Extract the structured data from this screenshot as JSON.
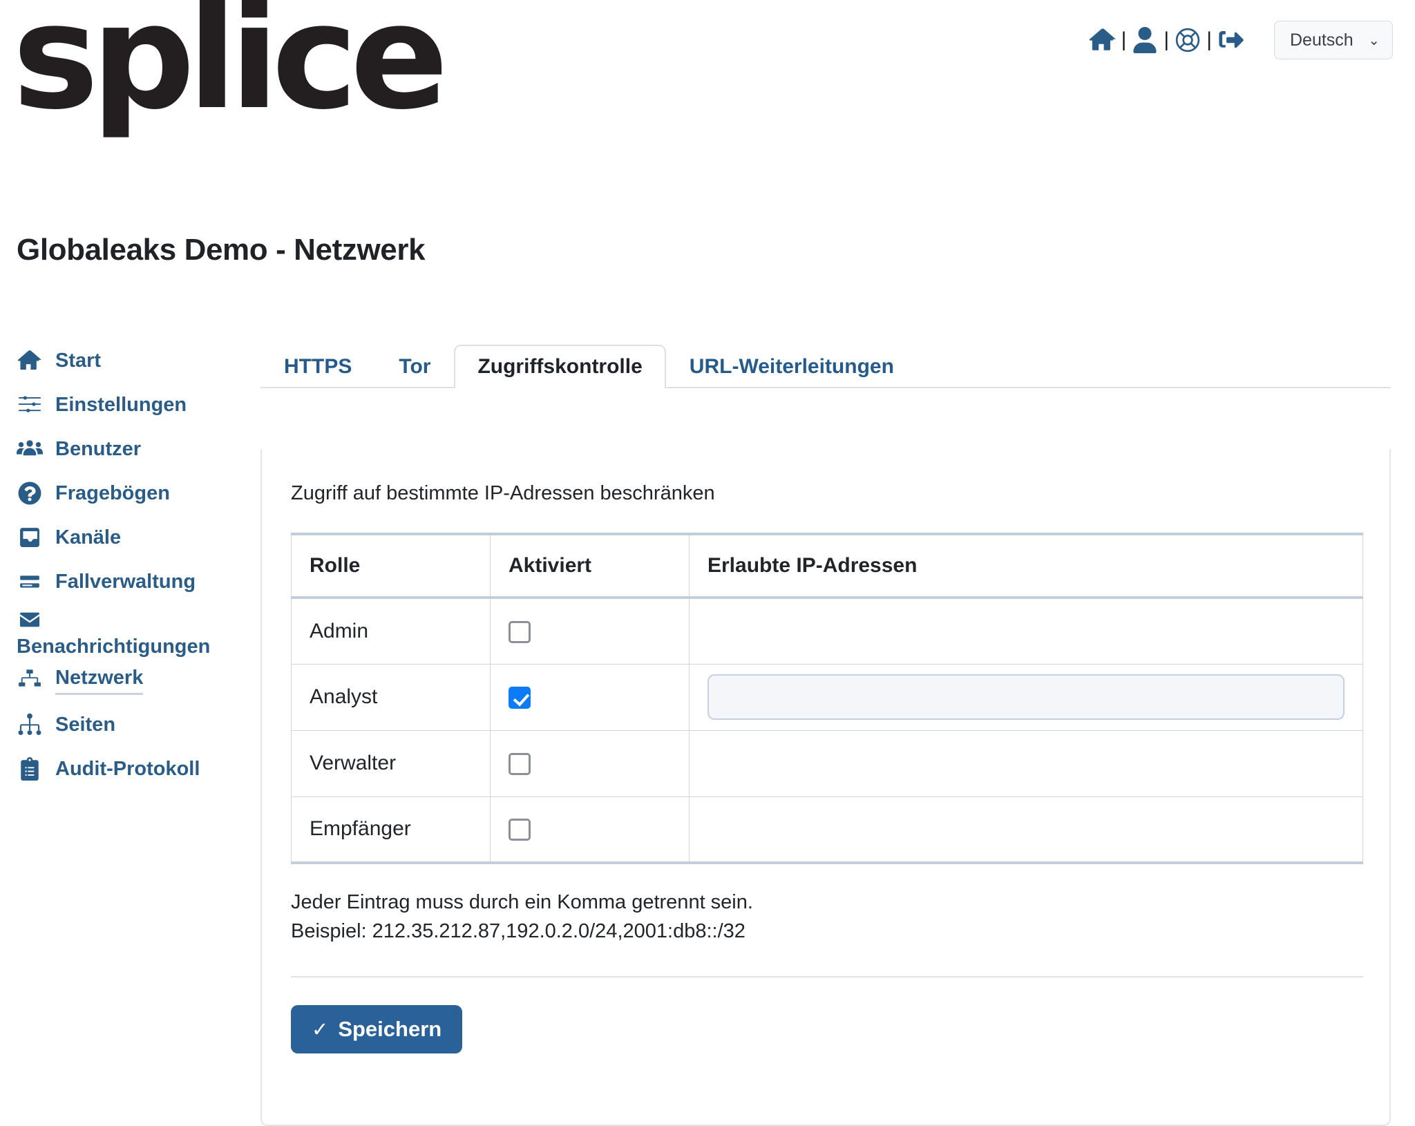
{
  "brand": {
    "logo_text": "splice"
  },
  "header": {
    "icons": [
      {
        "name": "home-icon",
        "label": "Start"
      },
      {
        "name": "user-icon",
        "label": "Konto"
      },
      {
        "name": "lifebuoy-icon",
        "label": "Hilfe"
      },
      {
        "name": "logout-icon",
        "label": "Abmelden"
      }
    ],
    "separator": "|",
    "language": {
      "value": "Deutsch",
      "chevron": "⌄"
    }
  },
  "page": {
    "title": "Globaleaks Demo - Netzwerk"
  },
  "sidebar": {
    "items": [
      {
        "label": "Start",
        "icon": "home-icon",
        "active": false
      },
      {
        "label": "Einstellungen",
        "icon": "sliders-icon",
        "active": false
      },
      {
        "label": "Benutzer",
        "icon": "users-icon",
        "active": false
      },
      {
        "label": "Fragebögen",
        "icon": "question-circle-icon",
        "active": false
      },
      {
        "label": "Kanäle",
        "icon": "inbox-icon",
        "active": false
      },
      {
        "label": "Fallverwaltung",
        "icon": "case-list-icon",
        "active": false
      },
      {
        "label": "Benachrichtigungen",
        "icon": "envelope-icon",
        "active": false
      },
      {
        "label": "Netzwerk",
        "icon": "network-icon",
        "active": true
      },
      {
        "label": "Seiten",
        "icon": "sitemap-icon",
        "active": false
      },
      {
        "label": "Audit-Protokoll",
        "icon": "clipboard-list-icon",
        "active": false
      }
    ]
  },
  "tabs": [
    {
      "label": "HTTPS",
      "active": false
    },
    {
      "label": "Tor",
      "active": false
    },
    {
      "label": "Zugriffskontrolle",
      "active": true
    },
    {
      "label": "URL-Weiterleitungen",
      "active": false
    }
  ],
  "main": {
    "section_label": "Zugriff auf bestimmte IP-Adressen beschränken",
    "table": {
      "headers": [
        "Rolle",
        "Aktiviert",
        "Erlaubte IP-Adressen"
      ],
      "rows": [
        {
          "role": "Admin",
          "enabled": false,
          "ips": "",
          "ips_visible": false
        },
        {
          "role": "Analyst",
          "enabled": true,
          "ips": "",
          "ips_visible": true
        },
        {
          "role": "Verwalter",
          "enabled": false,
          "ips": "",
          "ips_visible": false
        },
        {
          "role": "Empfänger",
          "enabled": false,
          "ips": "",
          "ips_visible": false
        }
      ]
    },
    "hint_line1": "Jeder Eintrag muss durch ein Komma getrennt sein.",
    "hint_line2": "Beispiel: 212.35.212.87,192.0.2.0/24,2001:db8::/32",
    "save_label": "Speichern",
    "save_icon": "✓"
  },
  "colors": {
    "brand_blue": "#2a5c88",
    "accent_checkbox": "#0d7bf7",
    "save_button": "#2a6199",
    "table_border": "#cdd7e3",
    "text_dark": "#212529"
  }
}
